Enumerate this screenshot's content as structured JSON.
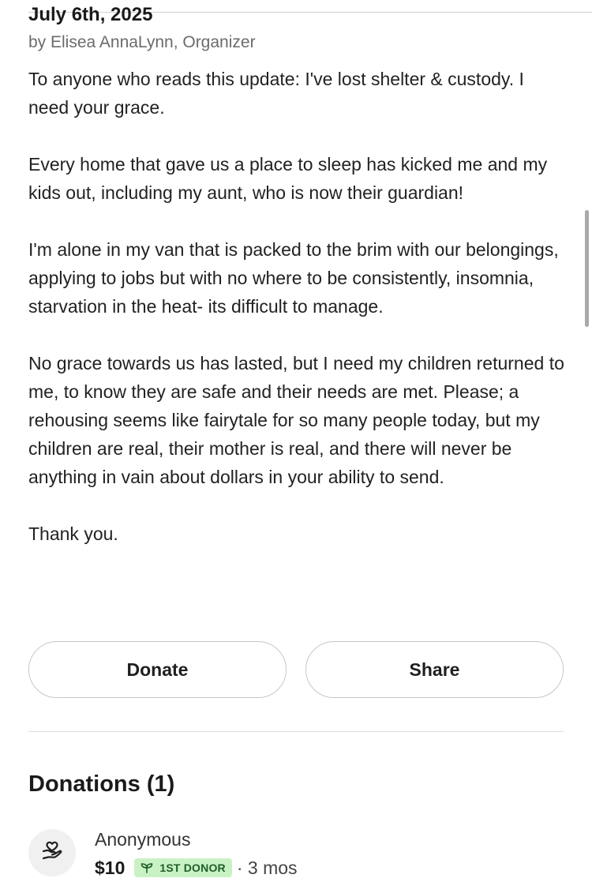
{
  "update": {
    "date": "July 6th, 2025",
    "byline": "by Elisea AnnaLynn, Organizer",
    "paragraphs": [
      "To anyone who reads this update: I've lost shelter & custody. I need your grace.",
      "Every home that gave us a place to sleep has kicked me and my kids out, including my aunt, who is now their guardian!",
      "I'm alone in my van that is packed to the brim with our belongings, applying to jobs but with no where to be consistently, insomnia, starvation in the heat- its difficult to manage.",
      "No grace towards us has lasted, but I need my children returned to me, to know they are safe and their needs are met. Please; a rehousing seems like fairytale for so many people today, but my children are real, their mother is real, and there will never be anything in vain about dollars in your ability to send.",
      "Thank you."
    ]
  },
  "actions": {
    "donate_label": "Donate",
    "share_label": "Share"
  },
  "donations": {
    "heading": "Donations (1)",
    "items": [
      {
        "name": "Anonymous",
        "amount": "$10",
        "badge": "1ST DONOR",
        "time": "· 3 mos",
        "avatar_icon": "heart-hand-icon",
        "badge_icon": "sprout-icon"
      }
    ]
  },
  "colors": {
    "badge_bg": "#c9f2c4",
    "badge_text": "#1f5d2c",
    "button_border": "#c7c7c7"
  }
}
